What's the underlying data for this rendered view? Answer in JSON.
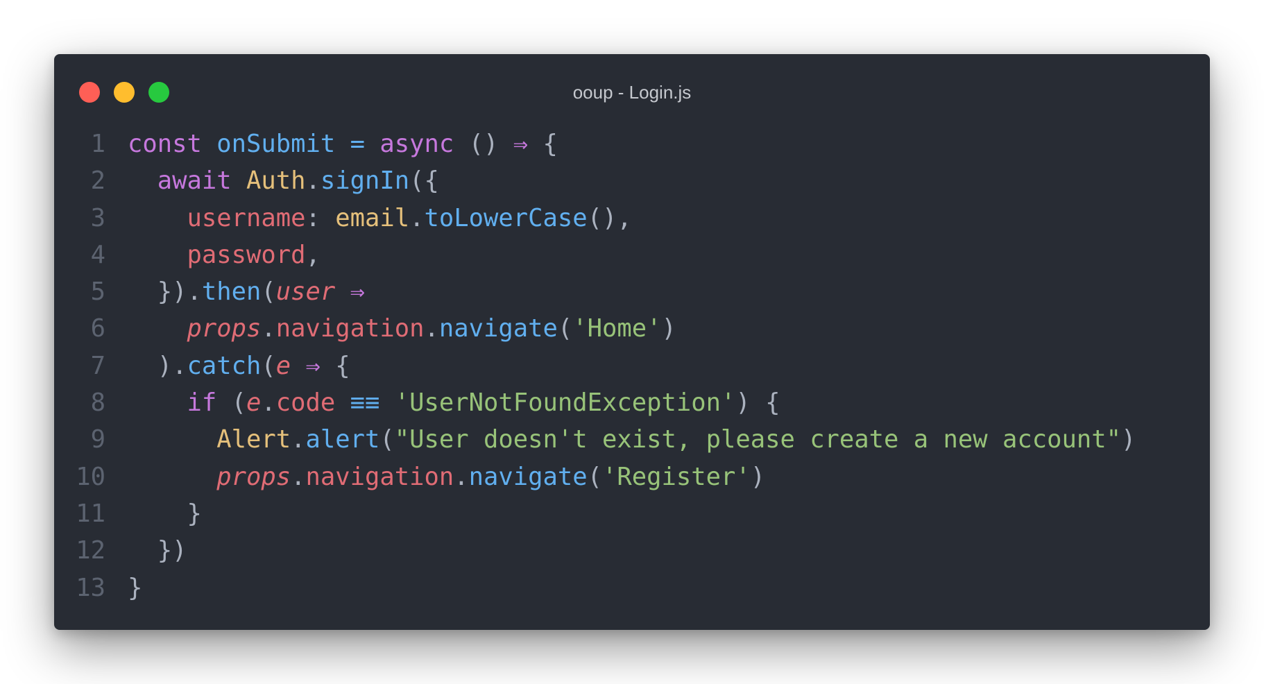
{
  "window": {
    "title": "ooup - Login.js"
  },
  "colors": {
    "background": "#282c34",
    "keyword": "#c678dd",
    "function": "#61afef",
    "class": "#e5c07b",
    "property": "#e06c75",
    "string": "#98c379",
    "punctuation": "#abb2bf",
    "line_number": "#5c6370"
  },
  "code": {
    "lines": [
      {
        "n": "1",
        "tokens": [
          {
            "t": "const ",
            "c": "keyword"
          },
          {
            "t": "onSubmit",
            "c": "function"
          },
          {
            "t": " ",
            "c": "punct"
          },
          {
            "t": "=",
            "c": "function"
          },
          {
            "t": " ",
            "c": "punct"
          },
          {
            "t": "async",
            "c": "keyword"
          },
          {
            "t": " () ",
            "c": "punct"
          },
          {
            "t": "⇒",
            "c": "keyword"
          },
          {
            "t": " {",
            "c": "punct"
          }
        ]
      },
      {
        "n": "2",
        "tokens": [
          {
            "t": "  ",
            "c": "punct"
          },
          {
            "t": "await",
            "c": "keyword"
          },
          {
            "t": " ",
            "c": "punct"
          },
          {
            "t": "Auth",
            "c": "class"
          },
          {
            "t": ".",
            "c": "punct"
          },
          {
            "t": "signIn",
            "c": "function"
          },
          {
            "t": "({",
            "c": "punct"
          }
        ]
      },
      {
        "n": "3",
        "tokens": [
          {
            "t": "    ",
            "c": "punct"
          },
          {
            "t": "username",
            "c": "prop"
          },
          {
            "t": ": ",
            "c": "punct"
          },
          {
            "t": "email",
            "c": "class"
          },
          {
            "t": ".",
            "c": "punct"
          },
          {
            "t": "toLowerCase",
            "c": "function"
          },
          {
            "t": "(),",
            "c": "punct"
          }
        ]
      },
      {
        "n": "4",
        "tokens": [
          {
            "t": "    ",
            "c": "punct"
          },
          {
            "t": "password",
            "c": "prop"
          },
          {
            "t": ",",
            "c": "punct"
          }
        ]
      },
      {
        "n": "5",
        "tokens": [
          {
            "t": "  }).",
            "c": "punct"
          },
          {
            "t": "then",
            "c": "function"
          },
          {
            "t": "(",
            "c": "punct"
          },
          {
            "t": "user",
            "c": "variable"
          },
          {
            "t": " ",
            "c": "punct"
          },
          {
            "t": "⇒",
            "c": "keyword"
          }
        ]
      },
      {
        "n": "6",
        "tokens": [
          {
            "t": "    ",
            "c": "punct"
          },
          {
            "t": "props",
            "c": "variable"
          },
          {
            "t": ".",
            "c": "punct"
          },
          {
            "t": "navigation",
            "c": "prop"
          },
          {
            "t": ".",
            "c": "punct"
          },
          {
            "t": "navigate",
            "c": "function"
          },
          {
            "t": "(",
            "c": "punct"
          },
          {
            "t": "'Home'",
            "c": "string"
          },
          {
            "t": ")",
            "c": "punct"
          }
        ]
      },
      {
        "n": "7",
        "tokens": [
          {
            "t": "  ).",
            "c": "punct"
          },
          {
            "t": "catch",
            "c": "function"
          },
          {
            "t": "(",
            "c": "punct"
          },
          {
            "t": "e",
            "c": "variable"
          },
          {
            "t": " ",
            "c": "punct"
          },
          {
            "t": "⇒",
            "c": "keyword"
          },
          {
            "t": " {",
            "c": "punct"
          }
        ]
      },
      {
        "n": "8",
        "tokens": [
          {
            "t": "    ",
            "c": "punct"
          },
          {
            "t": "if",
            "c": "keyword"
          },
          {
            "t": " (",
            "c": "punct"
          },
          {
            "t": "e",
            "c": "variable"
          },
          {
            "t": ".",
            "c": "punct"
          },
          {
            "t": "code",
            "c": "prop"
          },
          {
            "t": " ",
            "c": "punct"
          },
          {
            "t": "≡≡",
            "c": "function"
          },
          {
            "t": " ",
            "c": "punct"
          },
          {
            "t": "'UserNotFoundException'",
            "c": "string"
          },
          {
            "t": ") {",
            "c": "punct"
          }
        ]
      },
      {
        "n": "9",
        "tokens": [
          {
            "t": "      ",
            "c": "punct"
          },
          {
            "t": "Alert",
            "c": "class"
          },
          {
            "t": ".",
            "c": "punct"
          },
          {
            "t": "alert",
            "c": "function"
          },
          {
            "t": "(",
            "c": "punct"
          },
          {
            "t": "\"User doesn't exist, please create a new account\"",
            "c": "string"
          },
          {
            "t": ")",
            "c": "punct"
          }
        ]
      },
      {
        "n": "10",
        "tokens": [
          {
            "t": "      ",
            "c": "punct"
          },
          {
            "t": "props",
            "c": "variable"
          },
          {
            "t": ".",
            "c": "punct"
          },
          {
            "t": "navigation",
            "c": "prop"
          },
          {
            "t": ".",
            "c": "punct"
          },
          {
            "t": "navigate",
            "c": "function"
          },
          {
            "t": "(",
            "c": "punct"
          },
          {
            "t": "'Register'",
            "c": "string"
          },
          {
            "t": ")",
            "c": "punct"
          }
        ]
      },
      {
        "n": "11",
        "tokens": [
          {
            "t": "    }",
            "c": "punct"
          }
        ]
      },
      {
        "n": "12",
        "tokens": [
          {
            "t": "  })",
            "c": "punct"
          }
        ]
      },
      {
        "n": "13",
        "tokens": [
          {
            "t": "}",
            "c": "punct"
          }
        ]
      }
    ]
  }
}
